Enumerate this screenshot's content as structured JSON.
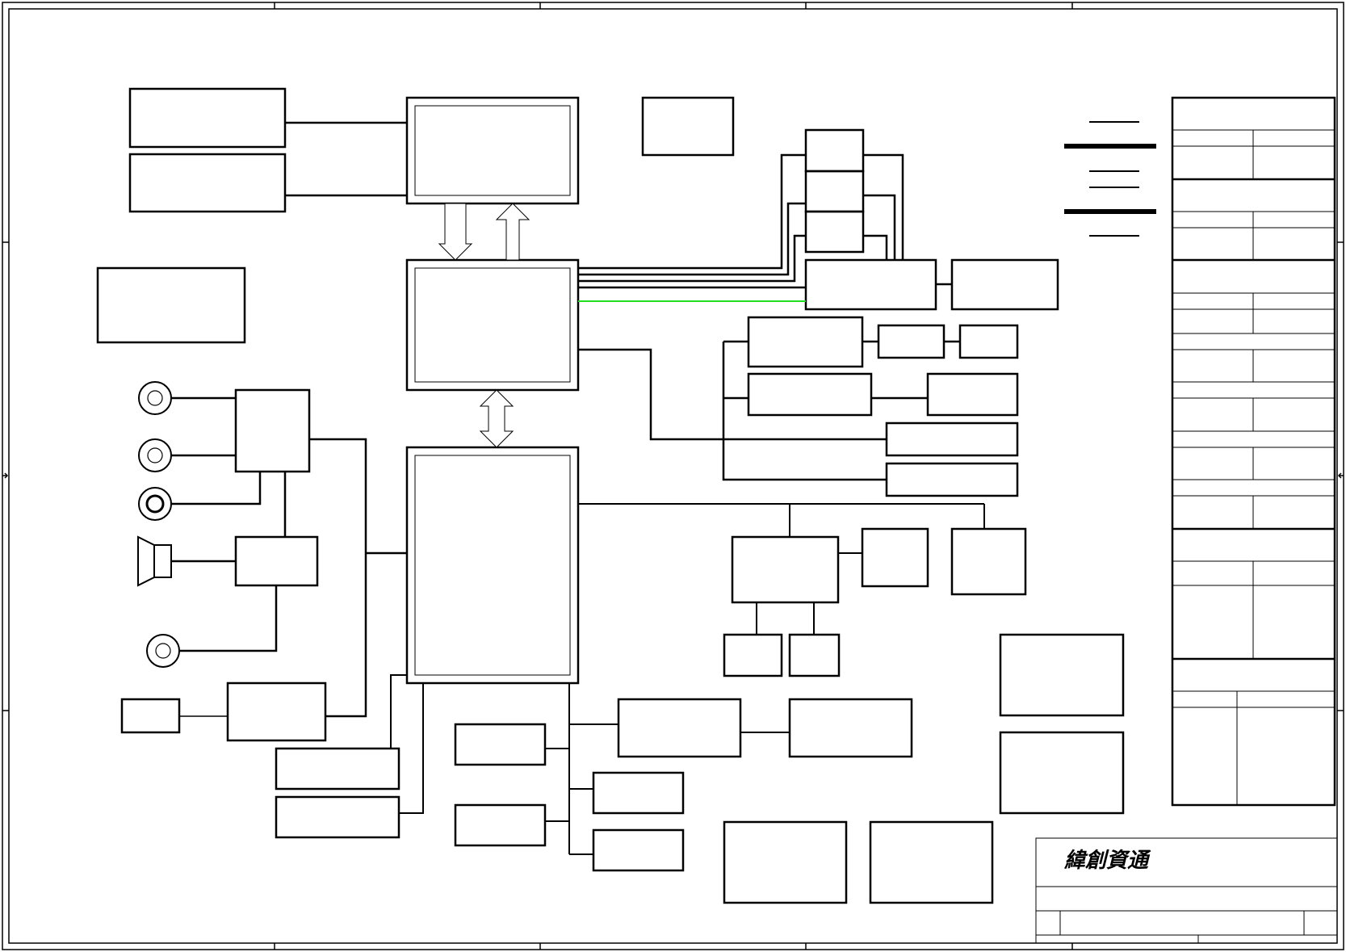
{
  "title_block": {
    "company_name": "緯創資通"
  },
  "colors": {
    "line": "#000000",
    "highlight_link": "#22dd22",
    "background": "#ffffff"
  }
}
